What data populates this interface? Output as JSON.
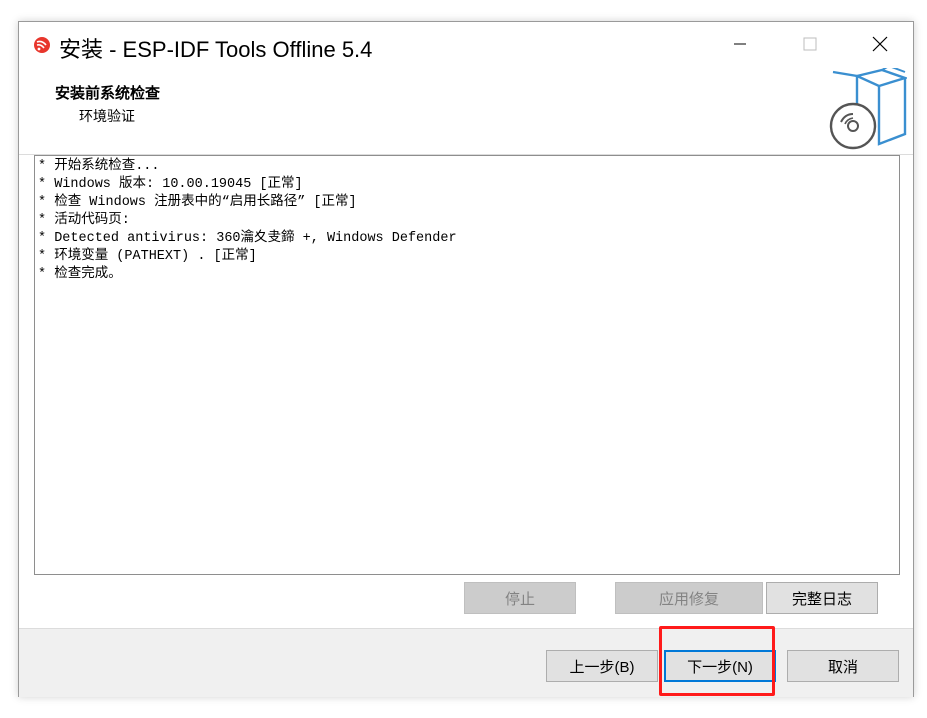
{
  "window": {
    "title": "安装 - ESP-IDF Tools Offline 5.4",
    "icons": {
      "app": "espressif-logo-icon",
      "minimize": "minimize-icon",
      "maximize": "maximize-icon",
      "close": "close-icon",
      "header_graphic": "package-disc-icon"
    }
  },
  "header": {
    "title": "安装前系统检查",
    "subtitle": "环境验证"
  },
  "log": {
    "lines": [
      "* 开始系统检查...",
      "* Windows 版本: 10.00.19045 [正常]",
      "* 检查 Windows 注册表中的“启用长路径” [正常]",
      "* 活动代码页:",
      "* Detected antivirus: 360瀹夊叏鍗 +, Windows Defender",
      "* 环境变量 (PATHEXT) . [正常]",
      "* 检查完成。"
    ]
  },
  "actions": {
    "stop": "停止",
    "apply_fix": "应用修复",
    "full_log": "完整日志"
  },
  "nav": {
    "back": "上一步(B)",
    "next": "下一步(N)",
    "cancel": "取消"
  },
  "colors": {
    "accent": "#0078d7",
    "highlight": "#ff1a1a",
    "brand": "#e8362c",
    "graphic": "#3a8fd0"
  }
}
